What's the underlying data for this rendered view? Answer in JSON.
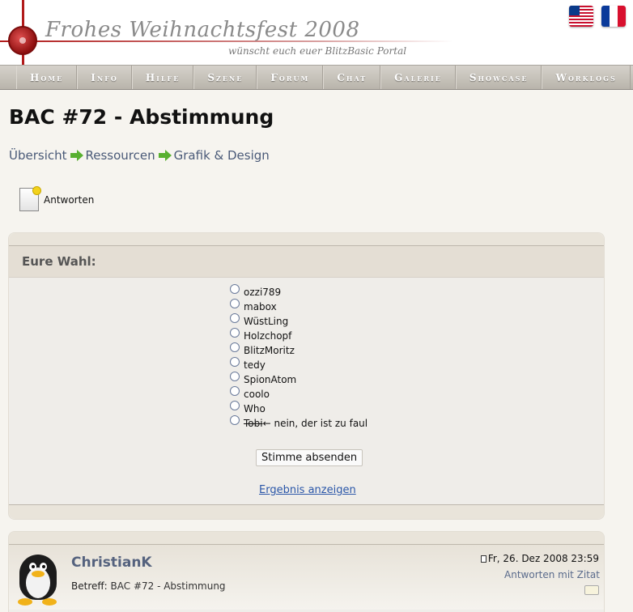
{
  "banner": {
    "title": "Frohes Weihnachtsfest 2008",
    "subtitle": "wünscht euch euer BlitzBasic Portal"
  },
  "languages": [
    {
      "icon": "us-flag-icon"
    },
    {
      "icon": "fr-flag-icon"
    }
  ],
  "nav": {
    "items": [
      "Home",
      "Info",
      "Hilfe",
      "Szene",
      "Forum",
      "Chat",
      "Galerie",
      "Showcase",
      "Worklogs"
    ]
  },
  "page": {
    "title": "BAC #72 - Abstimmung"
  },
  "breadcrumb": [
    "Übersicht",
    "Ressourcen",
    "Grafik & Design"
  ],
  "reply_label": "Antworten",
  "poll": {
    "heading": "Eure Wahl:",
    "options": [
      "ozzi789",
      "mabox",
      "WüstLing",
      "Holzchopf",
      "BlitzMoritz",
      "tedy",
      "SpionAtom",
      "coolo",
      "Who",
      "Tobi"
    ],
    "last_option_note": " ← nein, der ist zu faul",
    "submit_label": "Stimme absenden",
    "results_link": "Ergebnis anzeigen"
  },
  "post": {
    "author": "ChristianK",
    "subject_label": "Betreff:",
    "subject": "BAC #72 - Abstimmung",
    "date": "Fr, 26. Dez 2008 23:59",
    "quote_link": "Antworten mit Zitat"
  },
  "colors": {
    "accent": "#b11a1a",
    "link": "#2a56a8",
    "nav_bg": "#c8c3ba"
  }
}
